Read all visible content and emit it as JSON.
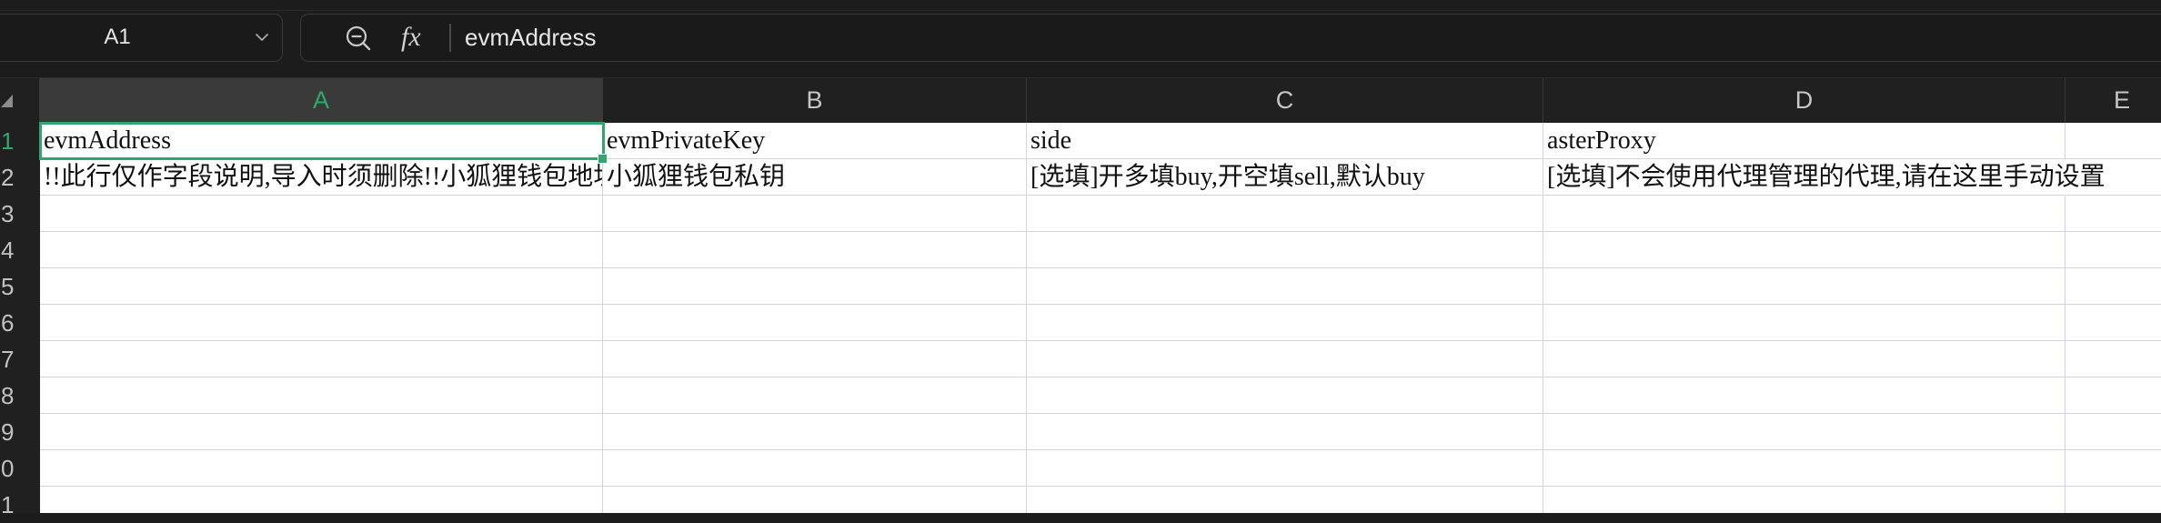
{
  "app": {
    "name_box": {
      "value": "A1"
    },
    "formula_bar": {
      "fx_label": "fx",
      "content": "evmAddress"
    }
  },
  "sheet": {
    "columns": [
      "A",
      "B",
      "C",
      "D",
      "E"
    ],
    "selection": {
      "column_index": 0,
      "row_index": 0
    },
    "rows": [
      {
        "label": "1",
        "cells": [
          "evmAddress",
          "evmPrivateKey",
          "side",
          "asterProxy",
          ""
        ]
      },
      {
        "label": "2",
        "cells": [
          "!!此行仅作字段说明,导入时须删除!!小狐狸钱包地址",
          "小狐狸钱包私钥",
          "[选填]开多填buy,开空填sell,默认buy",
          "[选填]不会使用代理管理的代理,请在这里手动设置",
          ""
        ]
      },
      {
        "label": "3",
        "cells": []
      },
      {
        "label": "4",
        "cells": []
      },
      {
        "label": "5",
        "cells": []
      },
      {
        "label": "6",
        "cells": []
      },
      {
        "label": "7",
        "cells": []
      },
      {
        "label": "8",
        "cells": []
      },
      {
        "label": "9",
        "cells": []
      },
      {
        "label": "0",
        "cells": []
      },
      {
        "label": "1",
        "cells": []
      }
    ]
  },
  "icons": {
    "name_box_dropdown": "chevron-down-icon",
    "formula_tool": "magnifier-icon",
    "select_all": "select-all-triangle-icon"
  },
  "colors": {
    "accent": "#2ea86e",
    "toolbar_bg": "#1c1c1c",
    "header_bg": "#202020",
    "header_selected_bg": "#3a3a3a",
    "grid_line": "#d0d6e1",
    "cell_bg": "#ffffff",
    "cell_text": "#111111"
  }
}
